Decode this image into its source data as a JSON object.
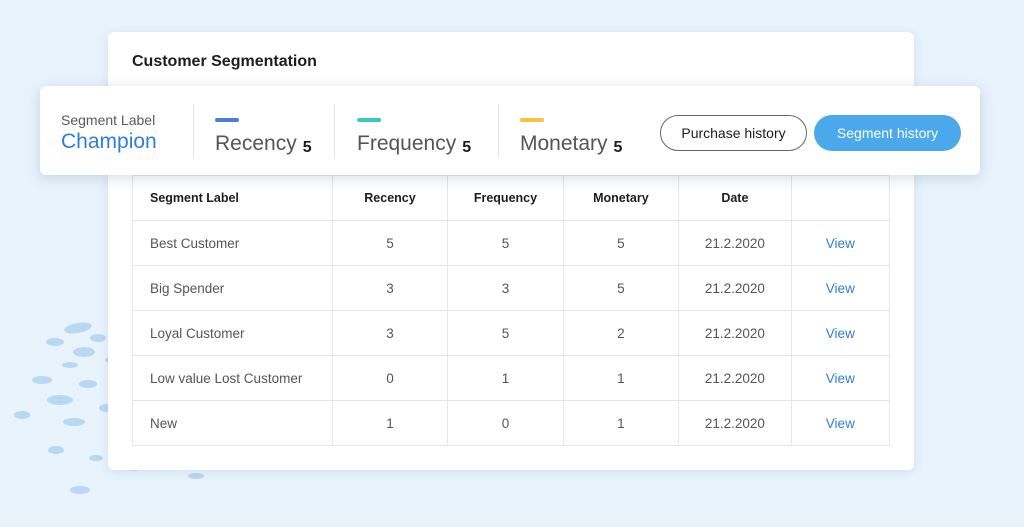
{
  "card": {
    "title": "Customer Segmentation"
  },
  "summary": {
    "segment_label_caption": "Segment Label",
    "segment_label_value": "Champion",
    "metrics": [
      {
        "name": "Recency",
        "value": "5",
        "color": "#4c7be0"
      },
      {
        "name": "Frequency",
        "value": "5",
        "color": "#3ec6b7"
      },
      {
        "name": "Monetary",
        "value": "5",
        "color": "#f5c342"
      }
    ],
    "purchase_history_label": "Purchase history",
    "segment_history_label": "Segment history"
  },
  "table": {
    "headers": [
      "Segment Label",
      "Recency",
      "Frequency",
      "Monetary",
      "Date",
      ""
    ],
    "rows": [
      {
        "label": "Best Customer",
        "recency": "5",
        "frequency": "5",
        "monetary": "5",
        "date": "21.2.2020",
        "action": "View"
      },
      {
        "label": "Big Spender",
        "recency": "3",
        "frequency": "3",
        "monetary": "5",
        "date": "21.2.2020",
        "action": "View"
      },
      {
        "label": "Loyal Customer",
        "recency": "3",
        "frequency": "5",
        "monetary": "2",
        "date": "21.2.2020",
        "action": "View"
      },
      {
        "label": "Low value Lost Customer",
        "recency": "0",
        "frequency": "1",
        "monetary": "1",
        "date": "21.2.2020",
        "action": "View"
      },
      {
        "label": "New",
        "recency": "1",
        "frequency": "0",
        "monetary": "1",
        "date": "21.2.2020",
        "action": "View"
      }
    ]
  }
}
